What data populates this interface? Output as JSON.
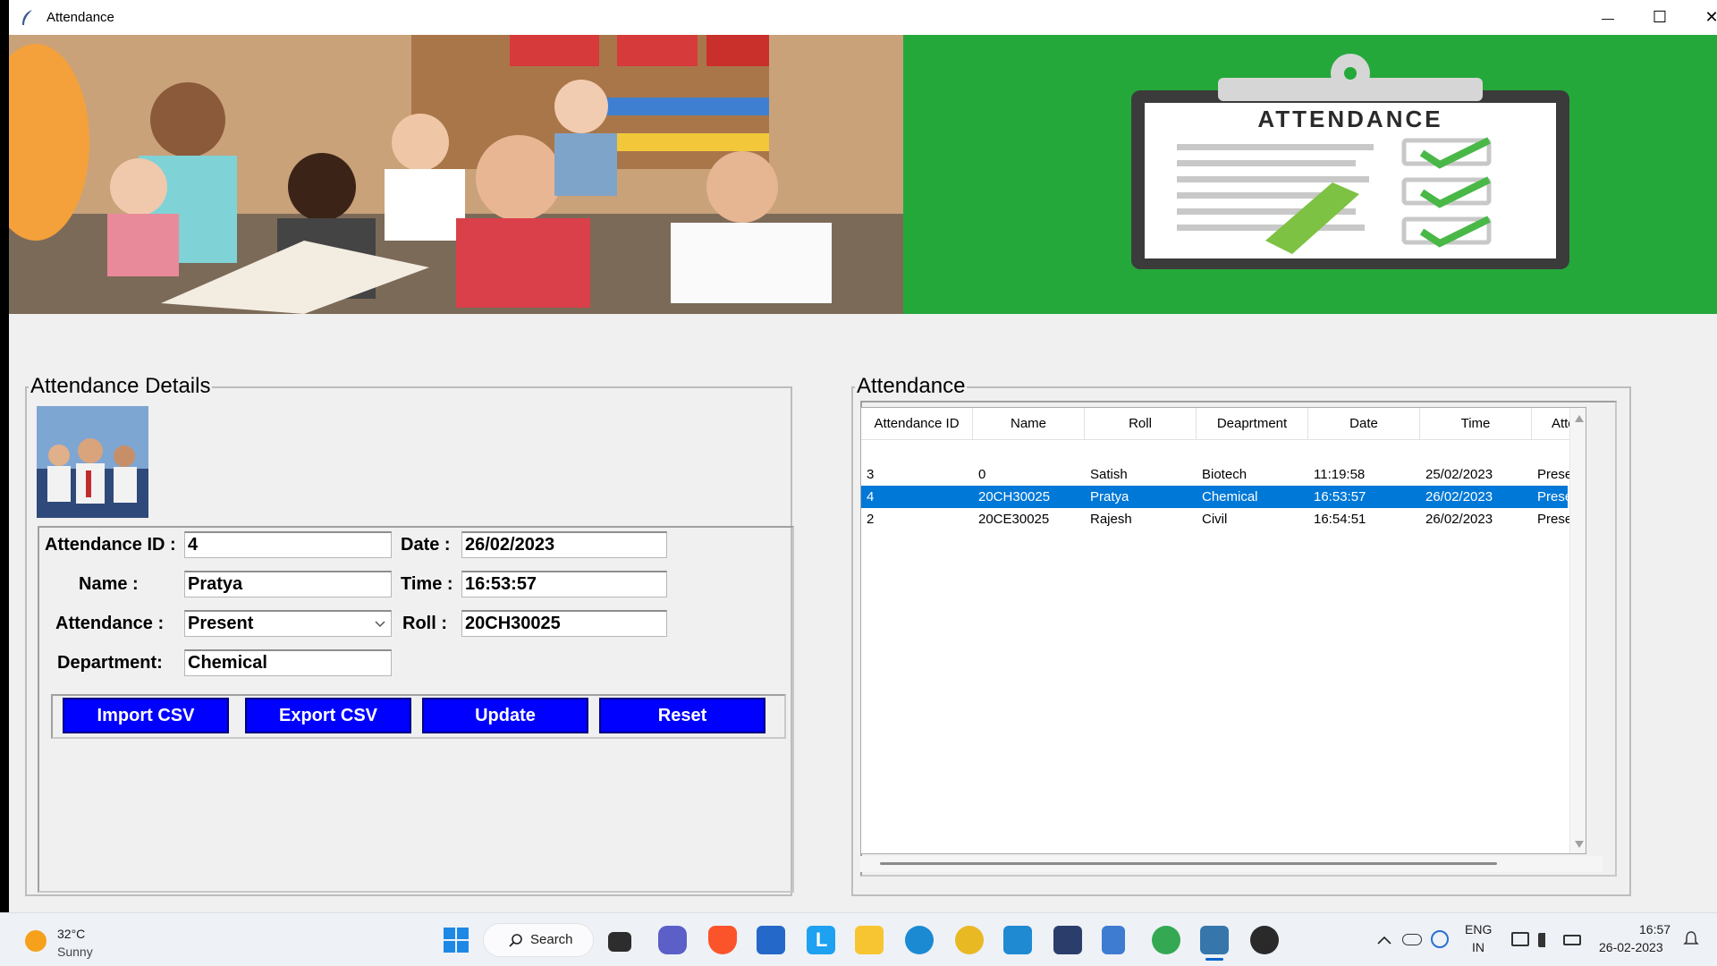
{
  "window": {
    "title": "Attendance",
    "controls": {
      "minimize": "—",
      "maximize": "☐",
      "close": "✕"
    }
  },
  "banner": {
    "clipboard_word": "ATTENDANCE",
    "accent_green": "#25a83a"
  },
  "details": {
    "frame_title": "Attendance Details",
    "labels": {
      "attendance_id": "Attendance ID :",
      "name": "Name :",
      "attendance": "Attendance :",
      "department": "Department:",
      "date": "Date :",
      "time": "Time :",
      "roll": "Roll :"
    },
    "values": {
      "attendance_id": "4",
      "name": "Pratya",
      "attendance": "Present",
      "department": "Chemical",
      "date": "26/02/2023",
      "time": "16:53:57",
      "roll": "20CH30025"
    },
    "buttons": {
      "import": "Import CSV",
      "export": "Export CSV",
      "update": "Update",
      "reset": "Reset"
    },
    "button_color": "#0000ff"
  },
  "table": {
    "frame_title": "Attendance",
    "columns": [
      "Attendance ID",
      "Name",
      "Roll",
      "Deaprtment",
      "Date",
      "Time",
      "Atten"
    ],
    "rows": [
      [
        "3",
        "0",
        "Satish",
        "Biotech",
        "11:19:58",
        "25/02/2023",
        "Present"
      ],
      [
        "4",
        "20CH30025",
        "Pratya",
        "Chemical",
        "16:53:57",
        "26/02/2023",
        "Present"
      ],
      [
        "2",
        "20CE30025",
        "Rajesh",
        "Civil",
        "16:54:51",
        "26/02/2023",
        "Present"
      ]
    ],
    "selected_row": 1,
    "selection_color": "#0078d7"
  },
  "taskbar": {
    "weather_temp": "32°C",
    "weather_text": "Sunny",
    "search_label": "Search",
    "lang_top": "ENG",
    "lang_bottom": "IN",
    "clock_time": "16:57",
    "clock_date": "26-02-2023",
    "app_icons": [
      "windows-start-icon",
      "task-view-icon",
      "chat-icon",
      "brave-icon",
      "store-icon",
      "l-app-icon",
      "file-explorer-icon",
      "edge-icon",
      "chrome-canary-icon",
      "vscode-icon",
      "pycharm-icon",
      "notepad-icon",
      "chrome-icon",
      "python-idle-icon",
      "media-player-icon"
    ]
  }
}
